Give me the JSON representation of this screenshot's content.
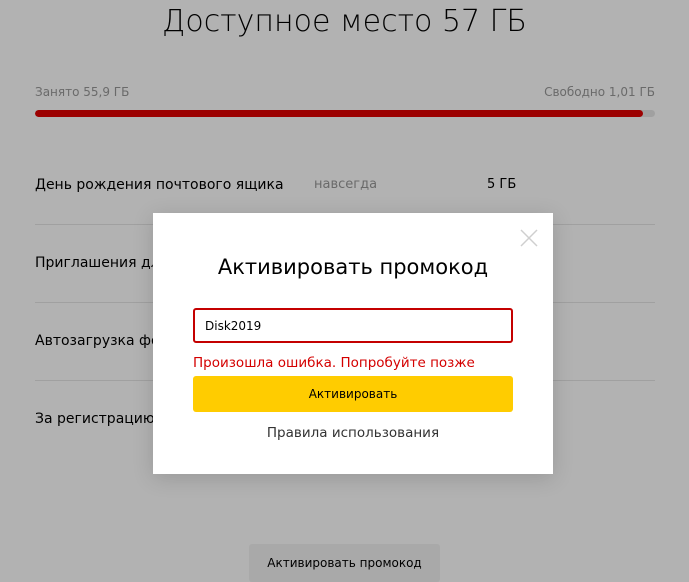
{
  "header": {
    "title": "Доступное место 57 ГБ"
  },
  "usage": {
    "used_label": "Занято 55,9 ГБ",
    "free_label": "Свободно 1,01 ГБ",
    "used_fraction": 0.98,
    "bar_color": "#e00000"
  },
  "space_items": [
    {
      "name": "День рождения почтового ящика",
      "period": "навсегда",
      "size": "5 ГБ"
    },
    {
      "name": "Приглашения дл",
      "period": "",
      "size": ""
    },
    {
      "name": "Автозагрузка фот",
      "period": "",
      "size": ""
    },
    {
      "name": "За регистрацию ,",
      "period": "",
      "size": ""
    }
  ],
  "bottom": {
    "activate_promo_label": "Активировать промокод"
  },
  "modal": {
    "title": "Активировать промокод",
    "input_value": "Disk2019",
    "error": "Произошла ошибка. Попробуйте позже",
    "activate_label": "Активировать",
    "rules_label": "Правила использования",
    "close_icon": "close-icon",
    "accent_color": "#ffcc00",
    "error_color": "#d40000"
  }
}
